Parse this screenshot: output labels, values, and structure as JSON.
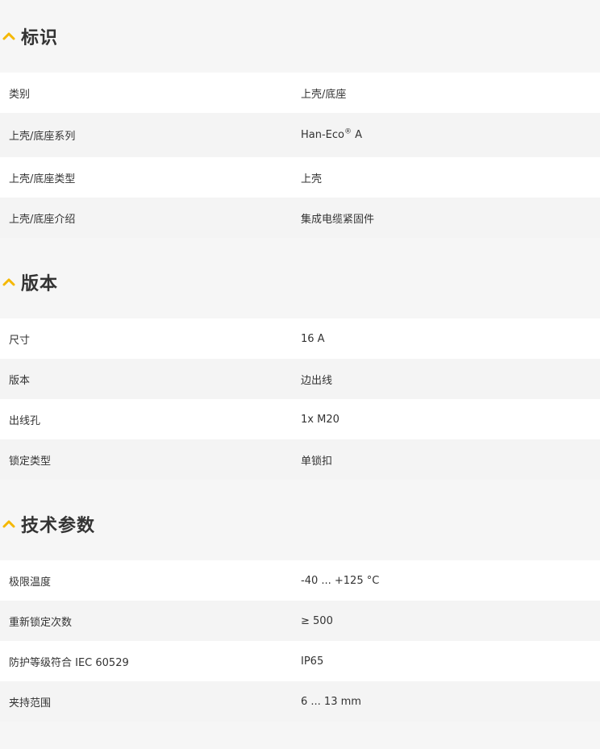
{
  "sections": [
    {
      "title": "标识",
      "rows": [
        {
          "label": "类别",
          "value": "上壳/底座"
        },
        {
          "label": "上壳/底座系列",
          "value": "Han-Eco",
          "value_sup": "®",
          "value_suffix": " A"
        },
        {
          "label": "上壳/底座类型",
          "value": "上壳"
        },
        {
          "label": "上壳/底座介绍",
          "value": "集成电缆紧固件"
        }
      ]
    },
    {
      "title": "版本",
      "rows": [
        {
          "label": "尺寸",
          "value": "16 A"
        },
        {
          "label": "版本",
          "value": "边出线"
        },
        {
          "label": "出线孔",
          "value": "1x M20"
        },
        {
          "label": "锁定类型",
          "value": "单锁扣"
        }
      ]
    },
    {
      "title": "技术参数",
      "rows": [
        {
          "label": "极限温度",
          "value": "-40 ... +125 °C"
        },
        {
          "label": "重新锁定次数",
          "value": "≥ 500"
        },
        {
          "label": "防护等级符合 IEC 60529",
          "value": "IP65"
        },
        {
          "label": "夹持范围",
          "value": "6 ... 13 mm"
        }
      ]
    }
  ],
  "colors": {
    "accent": "#f5b800",
    "row_white": "#ffffff",
    "row_grey": "#f4f4f4",
    "background": "#f6f6f6",
    "text": "#333333"
  },
  "icons": {
    "section_toggle": "chevron-up-icon"
  }
}
